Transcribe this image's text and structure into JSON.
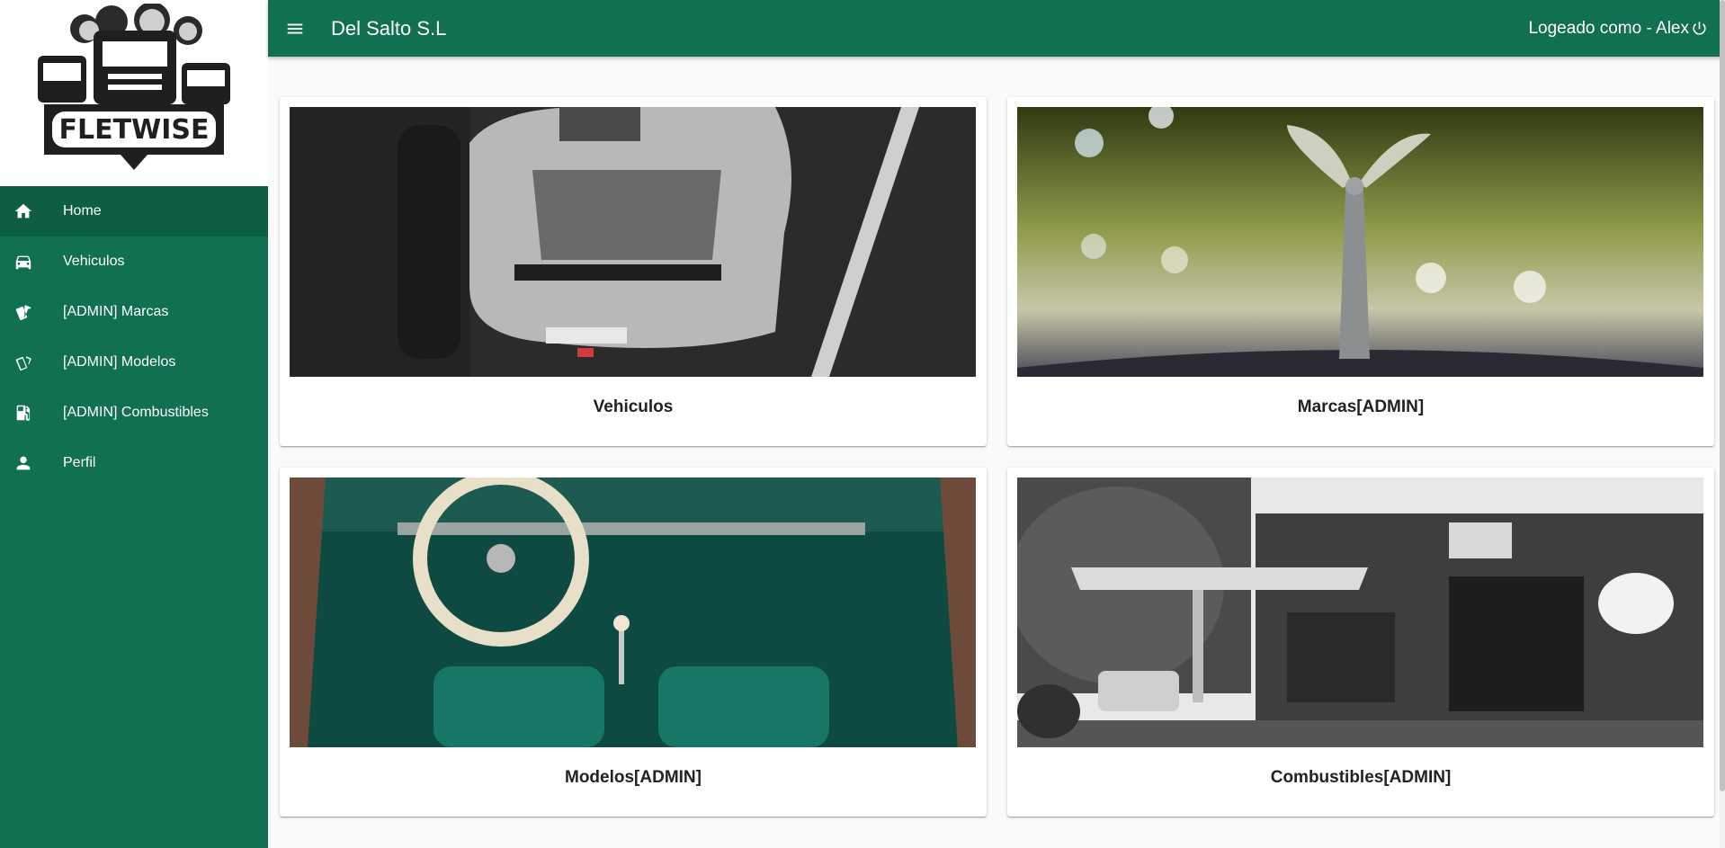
{
  "app": {
    "logo_text": "FLETWISE",
    "title": "Del Salto S.L",
    "user_label": "Logeado como - Alex"
  },
  "sidebar": {
    "items": [
      {
        "label": "Home",
        "icon": "home-icon"
      },
      {
        "label": "Vehiculos",
        "icon": "car-icon"
      },
      {
        "label": "[ADMIN] Marcas",
        "icon": "cards-icon"
      },
      {
        "label": "[ADMIN] Modelos",
        "icon": "cards-outline-icon"
      },
      {
        "label": "[ADMIN] Combustibles",
        "icon": "fuel-icon"
      },
      {
        "label": "Perfil",
        "icon": "person-icon"
      }
    ]
  },
  "cards": [
    {
      "title": "Vehiculos"
    },
    {
      "title": "Marcas[ADMIN]"
    },
    {
      "title": "Modelos[ADMIN]"
    },
    {
      "title": "Combustibles[ADMIN]"
    }
  ],
  "colors": {
    "primary": "#117051",
    "active": "#0d5e44"
  }
}
